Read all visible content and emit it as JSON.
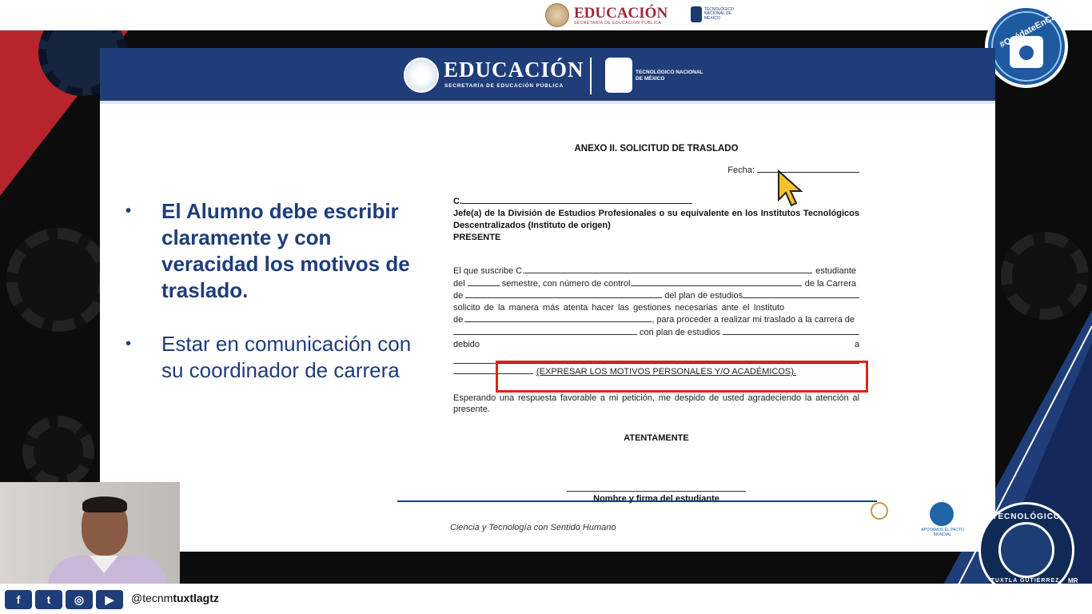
{
  "banner": {
    "education_word": "EDUCACIÓN",
    "education_sub": "SECRETARÍA DE EDUCACIÓN PÚBLICA",
    "hashtag": "#QuédateEnCasa",
    "tec_name": "TECNOLÓGICO NACIONAL DE MÉXICO",
    "campus_ring_top": "TECNOLÓGICO",
    "campus_ring_bottom": "TUXTLA GUTIÉRREZ, CHIS.",
    "mr": "MR"
  },
  "slide": {
    "header_title": "EDUCACIÓN",
    "header_sub": "SECRETARÍA DE EDUCACIÓN PÚBLICA",
    "header_tec": "TECNOLÓGICO NACIONAL DE MÉXICO",
    "bullets": [
      "El Alumno debe escribir claramente y con veracidad los motivos de traslado.",
      "Estar en comunicación con su coordinador de carrera"
    ],
    "bullet_glyph": "•"
  },
  "document": {
    "title": "ANEXO II. SOLICITUD DE TRASLADO",
    "fecha_label": "Fecha:",
    "addressee_prefix": "C.",
    "addressee_role": "Jefe(a) de la División de Estudios Profesionales o su equivalente en los Institutos Tecnológicos Descentralizados (Instituto de origen)",
    "presente": "PRESENTE",
    "line1_start": "El que suscribe C.",
    "line1_end": "estudiante",
    "line2_a": "del",
    "line2_b": "semestre, con número de control",
    "line2_c": "de la Carrera",
    "line3_a": "de",
    "line3_b": "del plan de estudios",
    "line4": "solicito de la manera más atenta hacer las gestiones necesarias ante el Instituto",
    "line5_a": "de",
    "line5_b": ", para proceder a realizar mi traslado a la carrera de",
    "line6_a": "con plan de estudios",
    "line7_a": "debido",
    "line7_b": "a",
    "motivos": "(EXPRESAR LOS MOTIVOS PERSONALES Y/O ACADÉMICOS).",
    "closing": "Esperando una respuesta favorable a mi petición, me despido de usted agradeciendo la atención al presente.",
    "atentamente": "ATENTAMENTE",
    "firma": "Nombre y firma del estudiante"
  },
  "footer": {
    "slogan": "Ciencia y Tecnología con Sentido Humano",
    "pacto": "APOYAMOS EL PACTO MUNDIAL"
  },
  "social": {
    "icons": [
      "f",
      "t",
      "◎",
      "▶"
    ],
    "handle_prefix": "@tecnm",
    "handle_bold": "tuxtlagtz"
  },
  "colors": {
    "navy": "#1f3d79",
    "red_highlight": "#e02418",
    "banner_red": "#b8242c",
    "cursor_yellow": "#f2c230"
  }
}
